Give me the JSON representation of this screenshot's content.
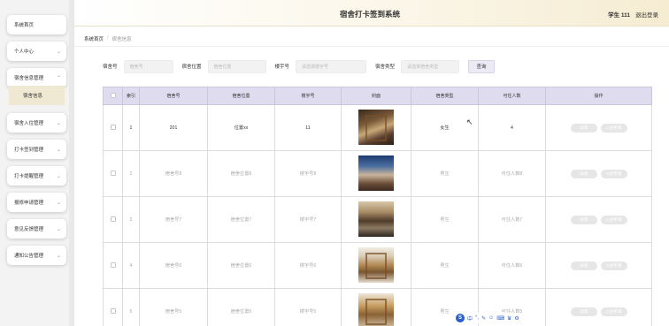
{
  "header": {
    "title": "宿舍打卡签到系统",
    "user": "学生 111",
    "logout": "退出登录"
  },
  "sidebar": {
    "items": [
      {
        "label": "系统首页",
        "has_chevron": false
      },
      {
        "label": "个人中心",
        "has_chevron": true
      },
      {
        "label": "宿舍信息管理",
        "has_chevron": true
      },
      {
        "label": "宿舍入住管理",
        "has_chevron": true
      },
      {
        "label": "打卡签到管理",
        "has_chevron": true
      },
      {
        "label": "打卡提醒管理",
        "has_chevron": true
      },
      {
        "label": "报修申请管理",
        "has_chevron": true
      },
      {
        "label": "意见反馈管理",
        "has_chevron": true
      },
      {
        "label": "通知公告管理",
        "has_chevron": true
      }
    ],
    "sub_item": "宿舍信息"
  },
  "breadcrumb": {
    "home": "系统首页",
    "separator": "/",
    "current": "宿舍信息"
  },
  "search": {
    "fields": [
      {
        "label": "宿舍号",
        "placeholder": "宿舍号"
      },
      {
        "label": "宿舍位置",
        "placeholder": "宿舍位置"
      },
      {
        "label": "楼宇号",
        "placeholder": "请选择楼宇号"
      },
      {
        "label": "宿舍类型",
        "placeholder": "请选择宿舍类型"
      }
    ],
    "button": "查询"
  },
  "table": {
    "columns": [
      "",
      "索引",
      "宿舍号",
      "宿舍位置",
      "楼宇号",
      "封面",
      "宿舍类型",
      "可住人数",
      "操作"
    ],
    "rows": [
      {
        "index": "1",
        "dorm_no": "201",
        "location": "位置xx",
        "building": "11",
        "type": "女生",
        "capacity": "4",
        "thumb": "t1"
      },
      {
        "index": "2",
        "dorm_no": "宿舍号8",
        "location": "宿舍位置8",
        "building": "楼宇号8",
        "type": "男生",
        "capacity": "可住人数8",
        "thumb": "t2"
      },
      {
        "index": "3",
        "dorm_no": "宿舍号7",
        "location": "宿舍位置7",
        "building": "楼宇号7",
        "type": "男生",
        "capacity": "可住人数7",
        "thumb": "t3"
      },
      {
        "index": "4",
        "dorm_no": "宿舍号6",
        "location": "宿舍位置6",
        "building": "楼宇号6",
        "type": "男生",
        "capacity": "可住人数6",
        "thumb": "t4"
      },
      {
        "index": "5",
        "dorm_no": "宿舍号5",
        "location": "宿舍位置5",
        "building": "楼宇号5",
        "type": "男生",
        "capacity": "可住人数5",
        "thumb": "t5"
      }
    ],
    "actions": {
      "detail": "详情",
      "checkin": "入住申请"
    }
  },
  "ime_toolbar": {
    "logo": "S",
    "label": "中"
  },
  "colors": {
    "table_header": "#dedcee",
    "selected_submenu": "#efe9d4",
    "header_gradient_end": "#f5ecd2"
  }
}
